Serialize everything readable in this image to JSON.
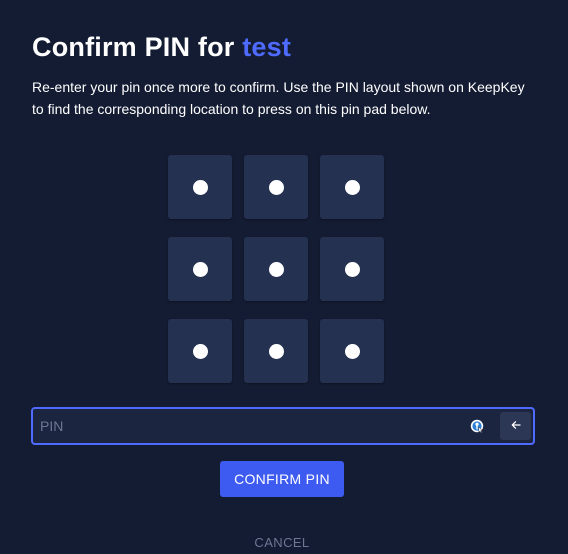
{
  "dialog": {
    "title_prefix": "Confirm PIN for",
    "wallet_name": "test",
    "description": "Re-enter your pin once more to confirm. Use the PIN layout shown on KeepKey to find the corresponding location to press on this pin pad below."
  },
  "pinpad": {
    "buttons": [
      {
        "position": "top-left"
      },
      {
        "position": "top-center"
      },
      {
        "position": "top-right"
      },
      {
        "position": "middle-left"
      },
      {
        "position": "middle-center"
      },
      {
        "position": "middle-right"
      },
      {
        "position": "bottom-left"
      },
      {
        "position": "bottom-center"
      },
      {
        "position": "bottom-right"
      }
    ],
    "dot_icon": "filled-circle"
  },
  "pin_field": {
    "value": "",
    "placeholder": "PIN",
    "password_manager_icon": "password-manager-icon",
    "backspace_icon": "arrow-left-icon"
  },
  "actions": {
    "confirm_label": "CONFIRM PIN",
    "cancel_label": "CANCEL"
  },
  "colors": {
    "background": "#141c33",
    "accent": "#3d5bf0",
    "wallet_name": "#4f6bff",
    "pin_button": "#243150",
    "muted_text": "#6d7693"
  }
}
